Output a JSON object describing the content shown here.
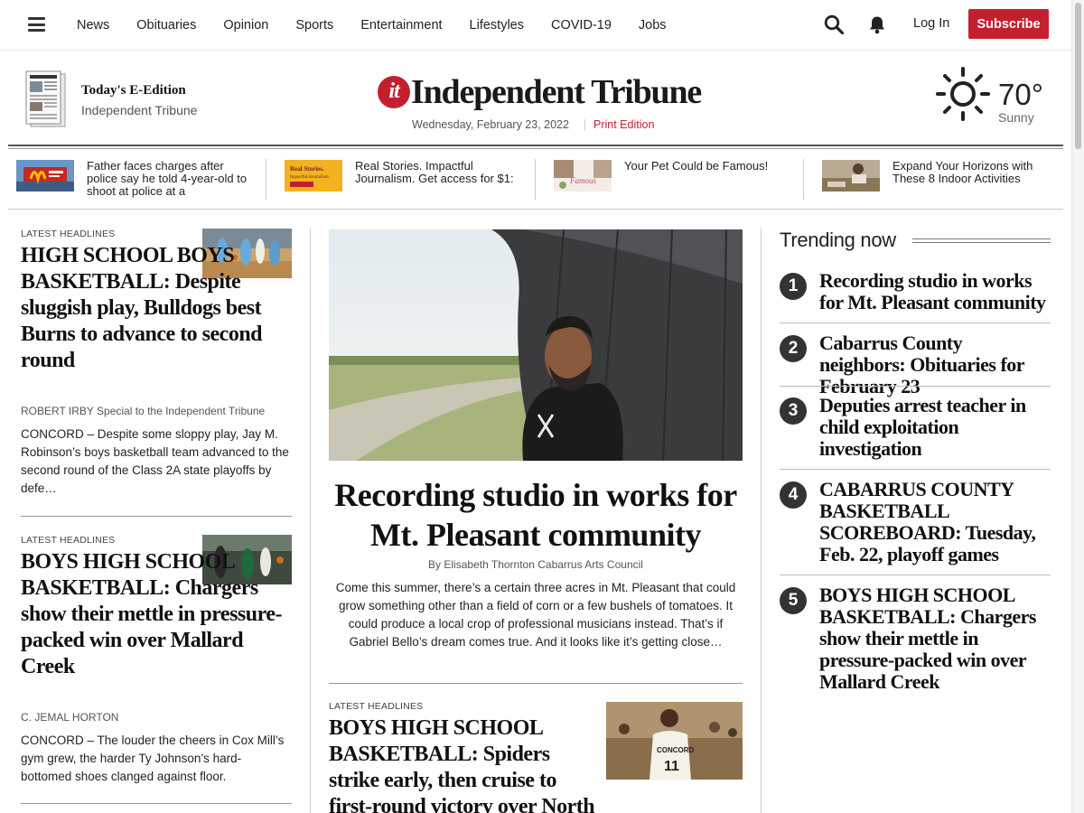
{
  "nav": {
    "links": [
      "News",
      "Obituaries",
      "Opinion",
      "Sports",
      "Entertainment",
      "Lifestyles",
      "COVID-19",
      "Jobs"
    ],
    "login_label": "Log In",
    "subscribe_label": "Subscribe",
    "icons": [
      "menu-icon",
      "search-icon",
      "bell-icon"
    ]
  },
  "masthead": {
    "eedition_title": "Today's E-Edition",
    "eedition_sub": "Independent Tribune",
    "logo_mark": "it",
    "logo_text": "Independent Tribune",
    "date": "Wednesday, February 23, 2022",
    "print_edition": "Print Edition",
    "weather": {
      "icon": "sun-icon",
      "temp": "70°",
      "condition": "Sunny"
    }
  },
  "promos": [
    {
      "text": "Father faces charges after police say he told 4-year-old to shoot at police at a",
      "image": "mcdonalds-sign-photo"
    },
    {
      "text": "Real Stories. Impactful Journalism. Get access for $1:",
      "image": "real-stories-ad"
    },
    {
      "text": "Your Pet Could be Famous!",
      "image": "pet-contest-ad"
    },
    {
      "text": "Expand Your Horizons with These 8 Indoor Activities",
      "image": "indoor-activities-photo"
    }
  ],
  "left_stories": [
    {
      "kicker": "LATEST HEADLINES",
      "headline": "HIGH SCHOOL BOYS BASKETBALL: Despite sluggish play, Bulldogs best Burns to advance to second round",
      "byline": "ROBERT IRBY Special to the Independent Tribune",
      "summary": "CONCORD – Despite some sloppy play, Jay M. Robinson’s boys basketball team advanced to the second round of the Class 2A state playoffs by defe…"
    },
    {
      "kicker": "LATEST HEADLINES",
      "headline": "BOYS HIGH SCHOOL BASKETBALL: Chargers show their mettle in pressure-packed win over Mallard Creek",
      "byline": "C. JEMAL HORTON",
      "summary": "CONCORD – The louder the cheers in Cox Mill’s gym grew, the harder Ty Johnson’s hard-bottomed shoes clanged against floor."
    }
  ],
  "hero": {
    "headline": "Recording studio in works for Mt. Pleasant community",
    "byline": "By Elisabeth Thornton Cabarrus Arts Council",
    "summary": "Come this summer, there’s a certain three acres in Mt. Pleasant that could grow something other than a field of corn or a few bushels of tomatoes. It could produce a local crop of professional musicians instead. That’s if Gabriel Bello’s dream comes true. And it looks like it’s getting close…"
  },
  "center_story2": {
    "kicker": "LATEST HEADLINES",
    "headline": "BOYS HIGH SCHOOL BASKETBALL: Spiders strike early, then cruise to first-round victory over North Henderson"
  },
  "trending": {
    "title": "Trending now",
    "items": [
      {
        "num": "1",
        "headline": "Recording studio in works for Mt. Pleasant community"
      },
      {
        "num": "2",
        "headline": "Cabarrus County neighbors: Obituaries for February 23"
      },
      {
        "num": "3",
        "headline": "Deputies arrest teacher in child exploitation investigation"
      },
      {
        "num": "4",
        "headline": "CABARRUS COUNTY BASKETBALL SCOREBOARD: Tuesday, Feb. 22, playoff games"
      },
      {
        "num": "5",
        "headline": "BOYS HIGH SCHOOL BASKETBALL: Chargers show their mettle in pressure-packed win over Mallard Creek"
      }
    ]
  },
  "colors": {
    "accent": "#c3202f",
    "text": "#222222",
    "rule": "#cccccc"
  }
}
